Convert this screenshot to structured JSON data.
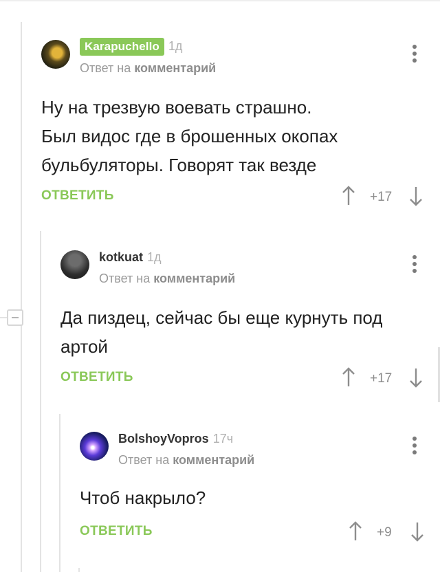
{
  "comments": [
    {
      "username": "Karapuchello",
      "time": "1д",
      "reply_prefix": "Ответ на",
      "reply_link": "комментарий",
      "text_lines": [
        "Ну на трезвую воевать страшно.",
        "Был видос где в брошенных окопах",
        "бульбуляторы. Говорят так везде"
      ],
      "reply_label": "ОТВЕТИТЬ",
      "rating": "+17"
    },
    {
      "username": "kotkuat",
      "time": "1д",
      "reply_prefix": "Ответ на",
      "reply_link": "комментарий",
      "text_lines": [
        "Да пиздец, сейчас бы еще курнуть под",
        "артой"
      ],
      "reply_label": "ОТВЕТИТЬ",
      "rating": "+17"
    },
    {
      "username": "BolshoyVopros",
      "time": "17ч",
      "reply_prefix": "Ответ на",
      "reply_link": "комментарий",
      "text_lines": [
        "Чтоб накрыло?"
      ],
      "reply_label": "ОТВЕТИТЬ",
      "rating": "+9"
    }
  ],
  "colors": {
    "accent": "#8ac858",
    "muted": "#9a9a9a",
    "text": "#222222",
    "thread_line": "#e3e3e3"
  },
  "icons": [
    "more-vertical-icon",
    "arrow-up-icon",
    "arrow-down-icon",
    "collapse-minus-icon"
  ]
}
